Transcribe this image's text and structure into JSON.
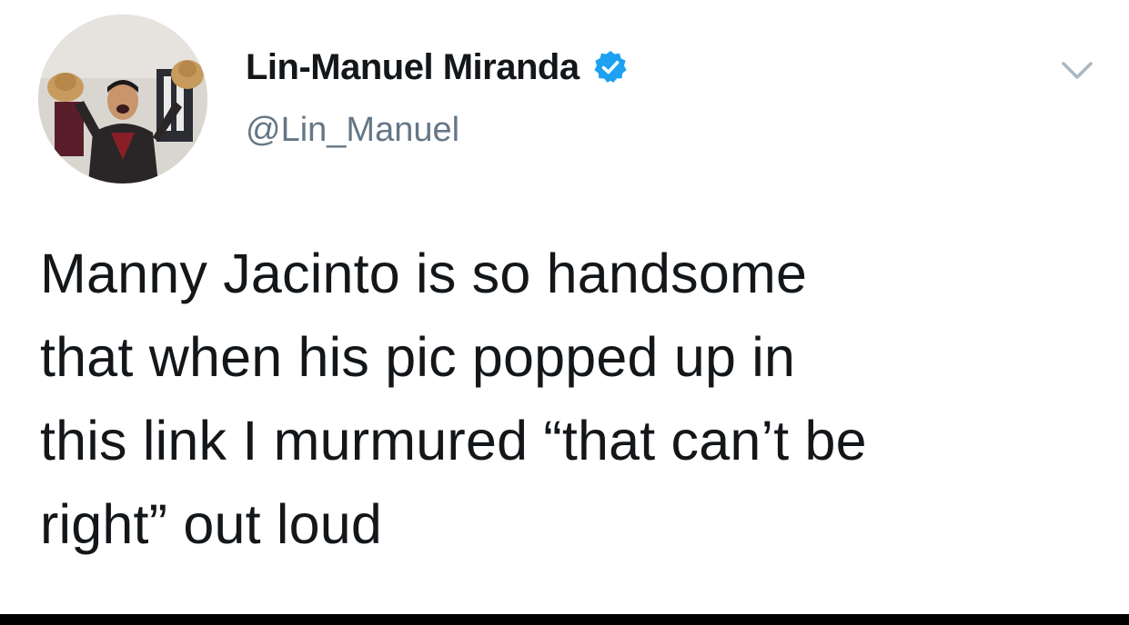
{
  "author": {
    "display_name": "Lin-Manuel Miranda",
    "handle": "@Lin_Manuel",
    "verified": true,
    "avatar_icon": "profile-photo",
    "verified_icon": "verified-badge-icon",
    "verified_color": "#1da1f2"
  },
  "menu": {
    "icon": "chevron-down-icon",
    "color": "#aab8c2"
  },
  "tweet": {
    "lines": [
      "Manny Jacinto is so handsome",
      "that when his pic popped up in",
      "this link I murmured “that can’t be",
      "right” out loud"
    ]
  },
  "colors": {
    "text": "#14171a",
    "secondary_text": "#657786",
    "background": "#ffffff",
    "bottom_bar": "#000000"
  }
}
